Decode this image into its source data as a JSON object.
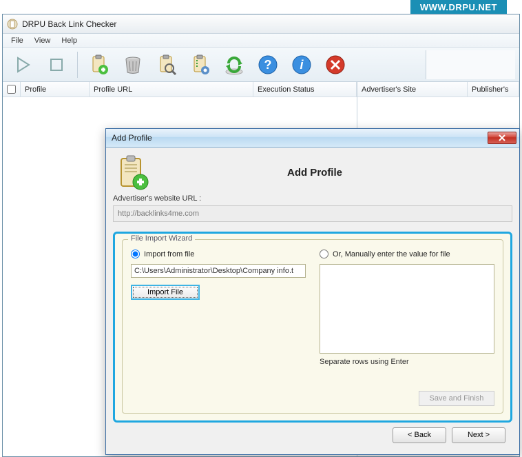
{
  "banner": "WWW.DRPU.NET",
  "titlebar": {
    "title": "DRPU Back Link Checker"
  },
  "menubar": {
    "file": "File",
    "view": "View",
    "help": "Help"
  },
  "columns": {
    "profile": "Profile",
    "profile_url": "Profile URL",
    "exec_status": "Execution Status",
    "adv_site": "Advertiser's Site",
    "publishers": "Publisher's"
  },
  "dialog": {
    "title": "Add Profile",
    "heading": "Add Profile",
    "url_label": "Advertiser's website URL :",
    "url_value": "http://backlinks4me.com",
    "wizard_legend": "File Import Wizard",
    "radio_import": "Import from file",
    "radio_manual": "Or, Manually enter the value for file",
    "file_path": "C:\\Users\\Administrator\\Desktop\\Company info.t",
    "import_btn": "Import File",
    "separate_label": "Separate rows using Enter",
    "save_finish": "Save and Finish",
    "back": "< Back",
    "next": "Next >"
  }
}
